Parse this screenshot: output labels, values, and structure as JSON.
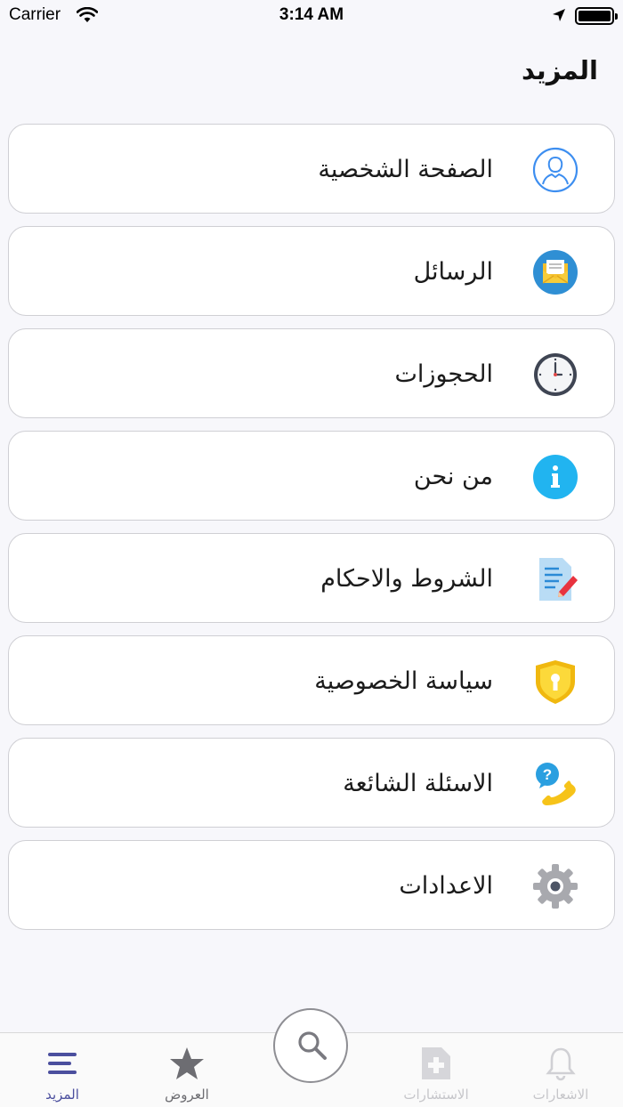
{
  "status_bar": {
    "carrier": "Carrier",
    "time": "3:14 AM"
  },
  "header": {
    "title": "المزيد"
  },
  "menu": {
    "items": [
      {
        "label": "الصفحة الشخصية",
        "icon": "profile-icon"
      },
      {
        "label": "الرسائل",
        "icon": "envelope-icon"
      },
      {
        "label": "الحجوزات",
        "icon": "clock-icon"
      },
      {
        "label": "من نحن",
        "icon": "info-icon"
      },
      {
        "label": "الشروط والاحكام",
        "icon": "document-edit-icon"
      },
      {
        "label": "سياسة الخصوصية",
        "icon": "shield-lock-icon"
      },
      {
        "label": "الاسئلة الشائعة",
        "icon": "phone-question-icon"
      },
      {
        "label": "الاعدادات",
        "icon": "gear-icon"
      }
    ]
  },
  "tab_bar": {
    "tabs": [
      {
        "label": "المزيد",
        "icon": "menu-lines-icon",
        "state": "active"
      },
      {
        "label": "العروض",
        "icon": "star-icon",
        "state": "normal"
      },
      {
        "label": "الاستشارات",
        "icon": "medical-file-icon",
        "state": "disabled"
      },
      {
        "label": "الاشعارات",
        "icon": "bell-icon",
        "state": "disabled"
      }
    ],
    "center_button_icon": "search-icon"
  },
  "colors": {
    "accent": "#4b4f9e",
    "background": "#f7f7fb",
    "card_border": "#cfcfd4"
  }
}
